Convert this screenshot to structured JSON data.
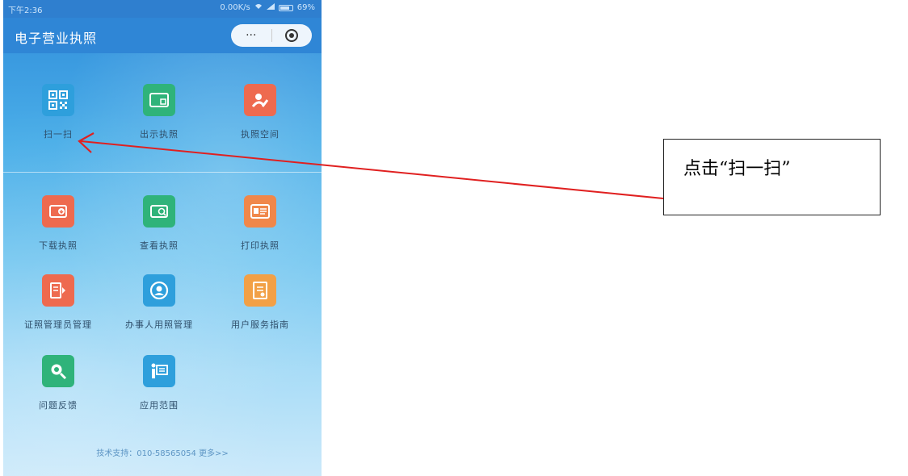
{
  "status_bar": {
    "time": "下午2:36",
    "network_speed": "0.00K/s",
    "battery": "69%"
  },
  "navbar": {
    "title": "电子营业执照",
    "more_label": "···"
  },
  "top_grid": [
    {
      "label": "扫一扫",
      "icon": "qr-scan-icon",
      "color": "#2e9fdc"
    },
    {
      "label": "出示执照",
      "icon": "license-card-icon",
      "color": "#2fb37a"
    },
    {
      "label": "执照空间",
      "icon": "license-space-icon",
      "color": "#ee6a4f"
    }
  ],
  "bottom_grid": [
    {
      "label": "下载执照",
      "icon": "download-license-icon",
      "color": "#ee6a4f"
    },
    {
      "label": "查看执照",
      "icon": "view-license-icon",
      "color": "#2fb37a"
    },
    {
      "label": "打印执照",
      "icon": "print-license-icon",
      "color": "#f0874a"
    },
    {
      "label": "证照管理员管理",
      "icon": "admin-manage-icon",
      "color": "#ee6a4f"
    },
    {
      "label": "办事人用照管理",
      "icon": "agent-manage-icon",
      "color": "#2e9fdc"
    },
    {
      "label": "用户服务指南",
      "icon": "user-guide-icon",
      "color": "#f2a046"
    },
    {
      "label": "问题反馈",
      "icon": "feedback-search-icon",
      "color": "#2fb37a"
    },
    {
      "label": "应用范围",
      "icon": "application-scope-icon",
      "color": "#2e9fdc"
    }
  ],
  "footer": {
    "text": "技术支持：010-58565054  更多>>"
  },
  "annotation": {
    "text": "点击“扫一扫”",
    "arrow_color": "#e02020"
  }
}
